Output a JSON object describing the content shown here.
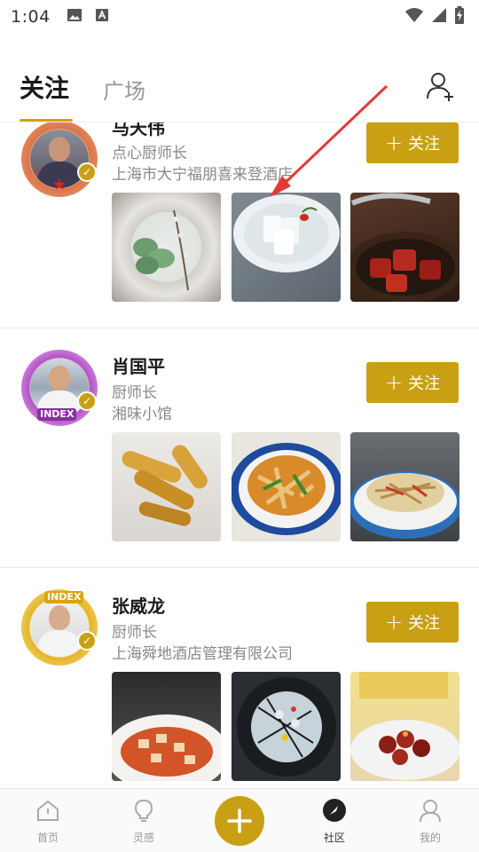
{
  "status_bar": {
    "time": "1:04",
    "left_icons": [
      "image-icon",
      "text-a-icon"
    ],
    "right_icons": [
      "wifi-icon",
      "signal-icon",
      "battery-charging-icon"
    ]
  },
  "header": {
    "tabs": [
      {
        "label": "关注",
        "active": true
      },
      {
        "label": "广场",
        "active": false
      }
    ],
    "add_friend_icon": "add-user-icon",
    "accent_color": "#d4a20f"
  },
  "feed": {
    "follow_label": "关注",
    "follow_plus": "+",
    "cards": [
      {
        "name": "马天伟",
        "title": "点心厨师长",
        "org": "上海市大宁福朋喜来登酒店",
        "avatar_frame": "bronze",
        "photos": [
          "green-dumplings-plate",
          "white-rice-cakes-bowl",
          "braised-pork-pot"
        ]
      },
      {
        "name": "肖国平",
        "title": "厨师长",
        "org": "湘味小馆",
        "avatar_frame": "purple",
        "badge_text": "INDEX",
        "photos": [
          "fried-dough-rolls",
          "stir-fried-pepper-dish",
          "shredded-salad-plate"
        ]
      },
      {
        "name": "张威龙",
        "title": "厨师长",
        "org": "上海舜地酒店管理有限公司",
        "avatar_frame": "gold",
        "badge_text": "INDEX",
        "photos": [
          "diced-tofu-red-sauce",
          "dark-plate-dessert",
          "braised-meatballs"
        ]
      }
    ]
  },
  "bottom_nav": {
    "items": [
      {
        "label": "首页",
        "icon": "home-icon",
        "active": false
      },
      {
        "label": "灵感",
        "icon": "lightbulb-icon",
        "active": false
      },
      {
        "label": "",
        "icon": "plus-icon",
        "active": false
      },
      {
        "label": "社区",
        "icon": "compass-icon",
        "active": true
      },
      {
        "label": "我的",
        "icon": "profile-icon",
        "active": false
      }
    ]
  },
  "colors": {
    "gold": "#c9a013",
    "annotation_red": "#e53935"
  }
}
